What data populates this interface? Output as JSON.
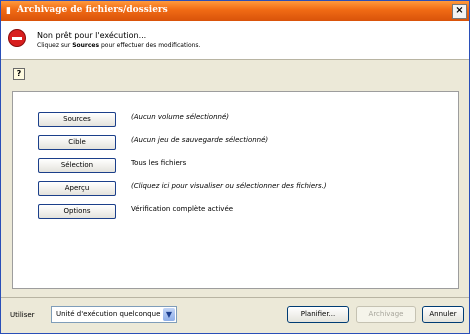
{
  "window": {
    "title": "Archivage de fichiers/dossiers",
    "close_label": "×"
  },
  "status": {
    "title": "Non prêt pour l'exécution...",
    "hint_prefix": "Cliquez sur ",
    "hint_bold": "Sources",
    "hint_suffix": " pour effectuer des modifications."
  },
  "help_label": "?",
  "rows": [
    {
      "button": "Sources",
      "description": "(Aucun volume sélectionné)"
    },
    {
      "button": "Cible",
      "description": "(Aucun jeu de sauvegarde sélectionné)"
    },
    {
      "button": "Sélection",
      "description": "Tous les fichiers"
    },
    {
      "button": "Aperçu",
      "description": "(Cliquez ici pour visualiser ou sélectionner des fichiers.)"
    },
    {
      "button": "Options",
      "description": "Vérification complète activée"
    }
  ],
  "footer": {
    "utiliser_label": "Utiliser",
    "combo_value": "Unité d'exécution quelconque",
    "planifier": "Planifier...",
    "archivage": "Archivage",
    "annuler": "Annuler"
  }
}
